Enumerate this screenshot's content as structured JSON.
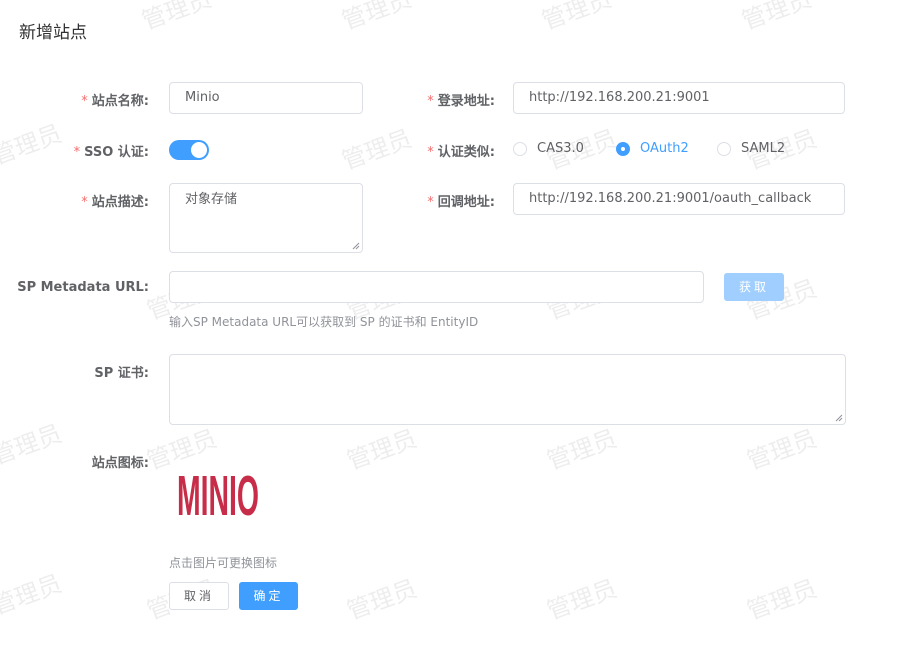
{
  "page": {
    "title": "新增站点"
  },
  "watermark": {
    "text": "管理员"
  },
  "form": {
    "site_name": {
      "label": "站点名称:",
      "value": "Minio"
    },
    "login_url": {
      "label": "登录地址:",
      "value": "http://192.168.200.21:9001"
    },
    "sso": {
      "label": "SSO 认证:",
      "enabled": true
    },
    "auth_type": {
      "label": "认证类似:",
      "options": [
        "CAS3.0",
        "OAuth2",
        "SAML2"
      ],
      "selected": "OAuth2"
    },
    "site_desc": {
      "label": "站点描述:",
      "value": "对象存储"
    },
    "callback_url": {
      "label": "回调地址:",
      "value": "http://192.168.200.21:9001/oauth_callback"
    },
    "sp_metadata": {
      "label": "SP Metadata URL:",
      "value": "",
      "fetch_label": "获取",
      "hint": "输入SP Metadata URL可以获取到 SP 的证书和 EntityID"
    },
    "sp_cert": {
      "label": "SP 证书:",
      "value": ""
    },
    "site_icon": {
      "label": "站点图标:",
      "logo_text": "MINIO",
      "hint": "点击图片可更换图标"
    }
  },
  "actions": {
    "cancel_label": "取消",
    "ok_label": "确定"
  },
  "colors": {
    "primary": "#409eff",
    "required": "#f56c6c",
    "logo": "#c72c48"
  }
}
